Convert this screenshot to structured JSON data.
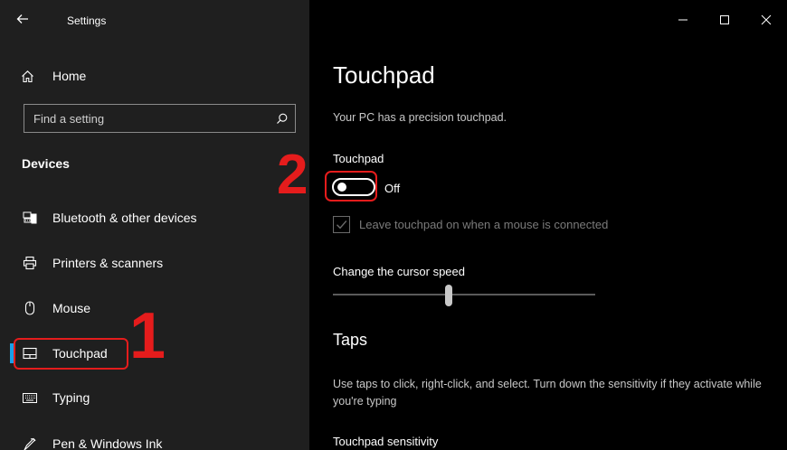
{
  "window": {
    "app_title": "Settings",
    "back_icon": "arrow-left-icon",
    "controls": [
      "minimize-icon",
      "maximize-icon",
      "close-icon"
    ]
  },
  "sidebar": {
    "home_label": "Home",
    "search_placeholder": "Find a setting",
    "section_title": "Devices",
    "items": [
      {
        "label": "Bluetooth & other devices",
        "icon": "bluetooth-devices-icon",
        "selected": false
      },
      {
        "label": "Printers & scanners",
        "icon": "printer-icon",
        "selected": false
      },
      {
        "label": "Mouse",
        "icon": "mouse-icon",
        "selected": false
      },
      {
        "label": "Touchpad",
        "icon": "touchpad-icon",
        "selected": true
      },
      {
        "label": "Typing",
        "icon": "keyboard-icon",
        "selected": false
      },
      {
        "label": "Pen & Windows Ink",
        "icon": "pen-icon",
        "selected": false
      }
    ]
  },
  "annotations": {
    "step1": "1",
    "step2": "2",
    "color": "#e51c1c"
  },
  "main": {
    "title": "Touchpad",
    "precision_text": "Your PC has a precision touchpad.",
    "toggle_label": "Touchpad",
    "toggle_state": "Off",
    "toggle_on": false,
    "leave_on_label": "Leave touchpad on when a mouse is connected",
    "leave_on_checked": true,
    "cursor_speed_label": "Change the cursor speed",
    "cursor_speed_fraction": 0.44,
    "taps_heading": "Taps",
    "taps_description": "Use taps to click, right-click, and select. Turn down the sensitivity if they activate while you're typing",
    "sensitivity_label": "Touchpad sensitivity"
  },
  "colors": {
    "sidebar_bg": "#1f1f1f",
    "main_bg": "#000000",
    "accent": "#1a9fe8",
    "annotation_red": "#e51c1c"
  }
}
